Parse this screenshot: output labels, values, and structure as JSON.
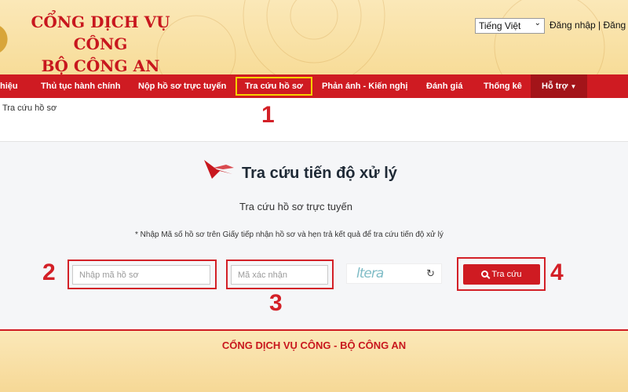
{
  "header": {
    "title_line1": "CỔNG DỊCH VỤ CÔNG",
    "title_line2": "BỘ CÔNG AN",
    "language": "Tiếng Việt",
    "auth_links": "Đăng nhập | Đăng"
  },
  "nav": {
    "items": [
      {
        "label": "hiệu"
      },
      {
        "label": "Thủ tục hành chính"
      },
      {
        "label": "Nộp hồ sơ trực tuyến"
      },
      {
        "label": "Tra cứu hồ sơ"
      },
      {
        "label": "Phản ánh - Kiến nghị"
      },
      {
        "label": "Đánh giá"
      },
      {
        "label": "Thống kê"
      },
      {
        "label": "Hỗ trợ"
      }
    ]
  },
  "breadcrumb": "Tra cứu hồ sơ",
  "panel": {
    "title": "Tra cứu tiến độ xử lý",
    "subtitle": "Tra cứu hồ sơ trực tuyến",
    "note": "* Nhập Mã số hồ sơ trên Giấy tiếp nhận hồ sơ và hẹn trả kết quả để tra cứu tiến độ xử lý",
    "file_code_placeholder": "Nhập mã hồ sơ",
    "captcha_placeholder": "Mã xác nhận",
    "captcha_text": "ltera",
    "search_label": "Tra cứu"
  },
  "annotations": [
    "1",
    "2",
    "3",
    "4"
  ],
  "footer": {
    "text": "CỔNG DỊCH VỤ CÔNG - BỘ CÔNG AN"
  },
  "colors": {
    "brand_red": "#cf1b22",
    "header_gold": "#f7dc98",
    "highlight_yellow": "#f5d100",
    "annotation_red": "#d32027"
  }
}
